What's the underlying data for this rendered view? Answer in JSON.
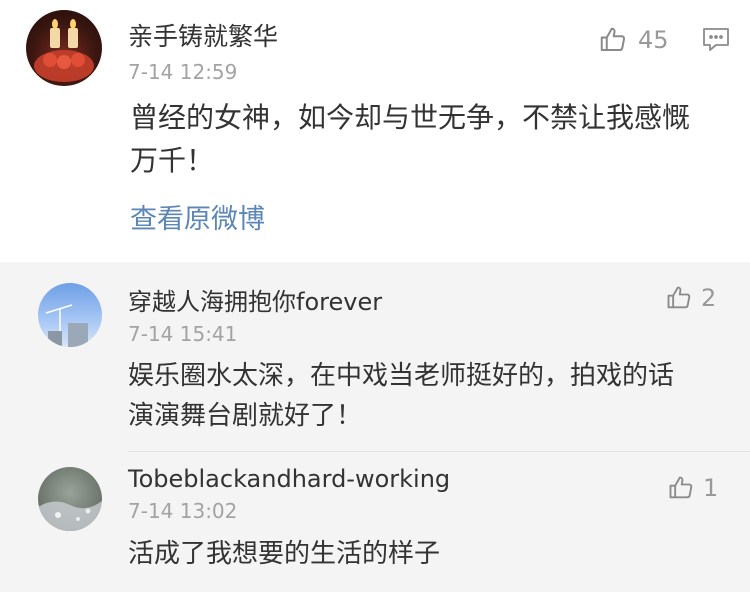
{
  "comments": [
    {
      "username": "亲手铸就繁华",
      "time": "7-14 12:59",
      "text": "曾经的女神，如今却与世无争，不禁让我感慨万千！",
      "likes": "45"
    }
  ],
  "view_original_link": "查看原微博",
  "replies": [
    {
      "username": "穿越人海拥抱你forever",
      "time": "7-14 15:41",
      "text": "娱乐圈水太深，在中戏当老师挺好的，拍戏的话演演舞台剧就好了！",
      "likes": "2"
    },
    {
      "username": "Tobeblackandhard-working",
      "time": "7-14 13:02",
      "text": "活成了我想要的生活的样子",
      "likes": "1"
    }
  ],
  "colors": {
    "link": "#5b86b5",
    "reply_background": "#f4f4f4",
    "meta_text": "#a3a3a3"
  },
  "icons": {
    "like": "thumbs-up-icon",
    "reply": "comment-icon"
  }
}
